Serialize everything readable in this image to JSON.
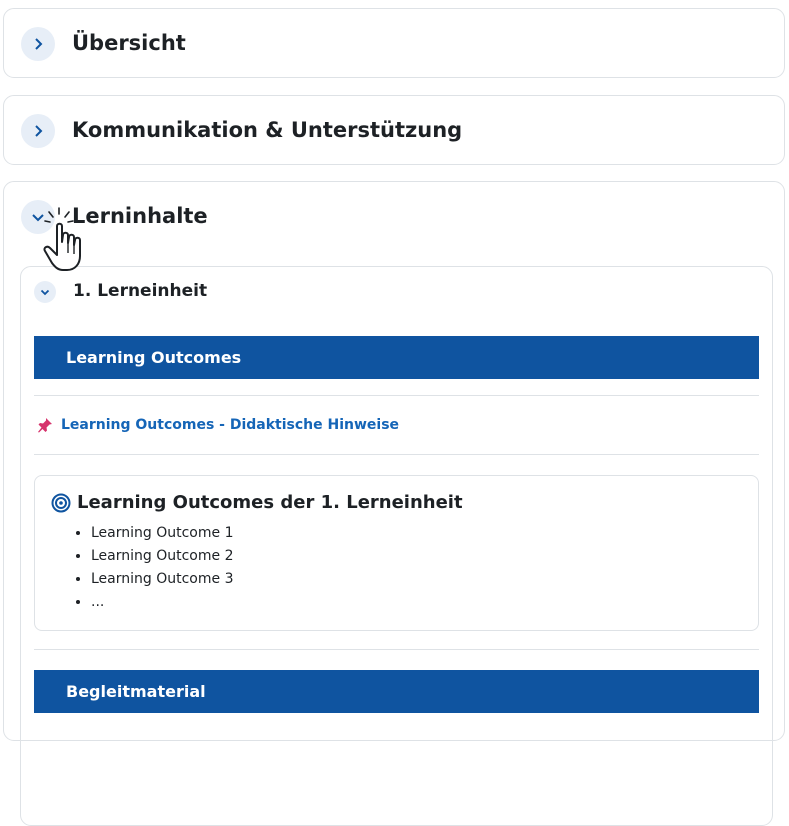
{
  "sections": {
    "overview": {
      "title": "Übersicht"
    },
    "communication": {
      "title": "Kommunikation & Unterstützung"
    },
    "content": {
      "title": "Lerninhalte"
    }
  },
  "unit": {
    "title": "1. Lerneinheit",
    "band_learning_outcomes": "Learning Outcomes",
    "resource_link": "Learning Outcomes - Didaktische Hinweise",
    "lo_heading": "Learning Outcomes der 1. Lerneinheit",
    "lo_items": [
      "Learning Outcome 1",
      "Learning Outcome 2",
      "Learning Outcome 3",
      "..."
    ],
    "band_material": "Begleitmaterial"
  },
  "colors": {
    "accent": "#0f54a0",
    "link": "#1565b7",
    "chevron_bg": "#e7eef7",
    "pin": "#d6336c"
  },
  "icons": {
    "collapsed": "chevron-right-icon",
    "expanded": "chevron-down-icon",
    "resource": "pin-icon",
    "heading": "target-icon",
    "pointer": "hand-pointer-cursor-icon"
  }
}
